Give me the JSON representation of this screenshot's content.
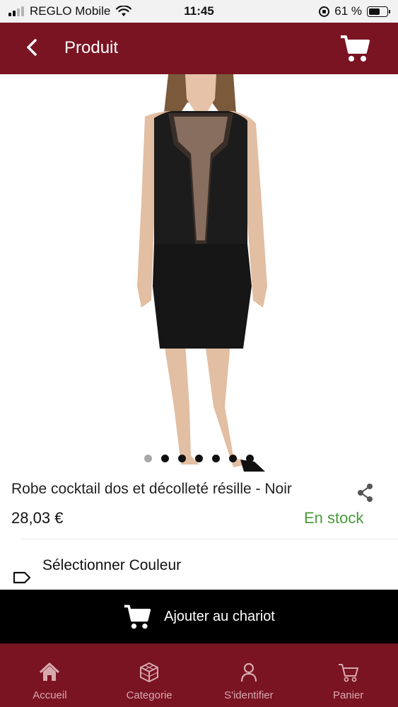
{
  "status_bar": {
    "carrier": "REGLO Mobile",
    "time": "11:45",
    "battery": "61 %",
    "battery_level": 0.61,
    "signal_bars": 2
  },
  "header": {
    "title": "Produit",
    "back_icon": "chevron-left-icon",
    "cart_icon": "cart-icon"
  },
  "product": {
    "image_icon": "product-photo",
    "carousel": {
      "total": 7,
      "active_index": 0
    },
    "name": "Robe cocktail dos et décolleté résille - Noir",
    "price": "28,03 €",
    "stock_status": "En stock",
    "share_icon": "share-icon"
  },
  "variant": {
    "label": "Sélectionner Couleur",
    "icon": "tag-icon"
  },
  "add_to_cart": {
    "label": "Ajouter au chariot",
    "icon": "cart-icon"
  },
  "bottom_nav": [
    {
      "label": "Accueil",
      "icon": "home-icon"
    },
    {
      "label": "Categorie",
      "icon": "cube-icon"
    },
    {
      "label": "S'identifier",
      "icon": "user-icon"
    },
    {
      "label": "Panier",
      "icon": "cart-outline-icon"
    }
  ],
  "colors": {
    "brand": "#7a1422",
    "nav_label": "#d7a9ae",
    "stock_green": "#4a9a3a",
    "add_cart_bg": "#000000"
  }
}
